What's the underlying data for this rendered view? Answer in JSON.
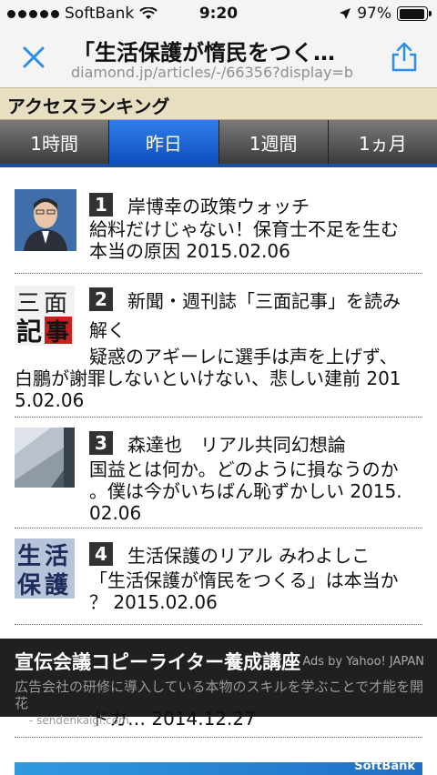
{
  "status": {
    "carrier": "SoftBank",
    "time": "9:20",
    "battery": "97%",
    "battery_level": 0.97
  },
  "browser": {
    "title": "「生活保護が惰民をつく…",
    "url": "diamond.jp/articles/-/66356?display=b"
  },
  "ranking": {
    "header": "アクセスランキング",
    "tabs": [
      "1時間",
      "昨日",
      "1週間",
      "1ヵ月"
    ],
    "active_tab": 1,
    "items": [
      {
        "rank": "1",
        "series": "岸博幸の政策ウォッチ",
        "line1": "給料だけじゃない！保育士不足を生む",
        "line2": "本当の原因 2015.02.06",
        "thumb_text": ""
      },
      {
        "rank": "2",
        "series": "新聞・週刊誌「三面記事」を読み",
        "series2": "解く",
        "line1": "疑惑のアギーレに選手は声を上げず、",
        "line2": "白鵬が謝罪しないといけない、悲しい建前 201",
        "line3": "5.02.06",
        "thumb_text": "三面記事"
      },
      {
        "rank": "3",
        "series": "森達也　リアル共同幻想論",
        "line1": "国益とは何か。どのように損なうのか",
        "line2": "。僕は今がいちばん恥ずかしい 2015.",
        "line3": "02.06",
        "thumb_text": ""
      },
      {
        "rank": "4",
        "series": "生活保護のリアル みわよしこ",
        "line1": "「生活保護が惰民をつくる」は本当か",
        "line2": "？ 2015.02.06",
        "thumb_text": "生活保護"
      }
    ],
    "peek_text": "ドカ… 2014.12.27"
  },
  "ad": {
    "title": "宣伝会議コピーライター養成講座",
    "by": "Ads by Yahoo! JAPAN",
    "desc": "広告会社の研修に導入している本物のスキルを学ぶことで才能を開花",
    "source": "- sendenkaigi.com"
  },
  "banner": {
    "text": "SoftBank"
  }
}
